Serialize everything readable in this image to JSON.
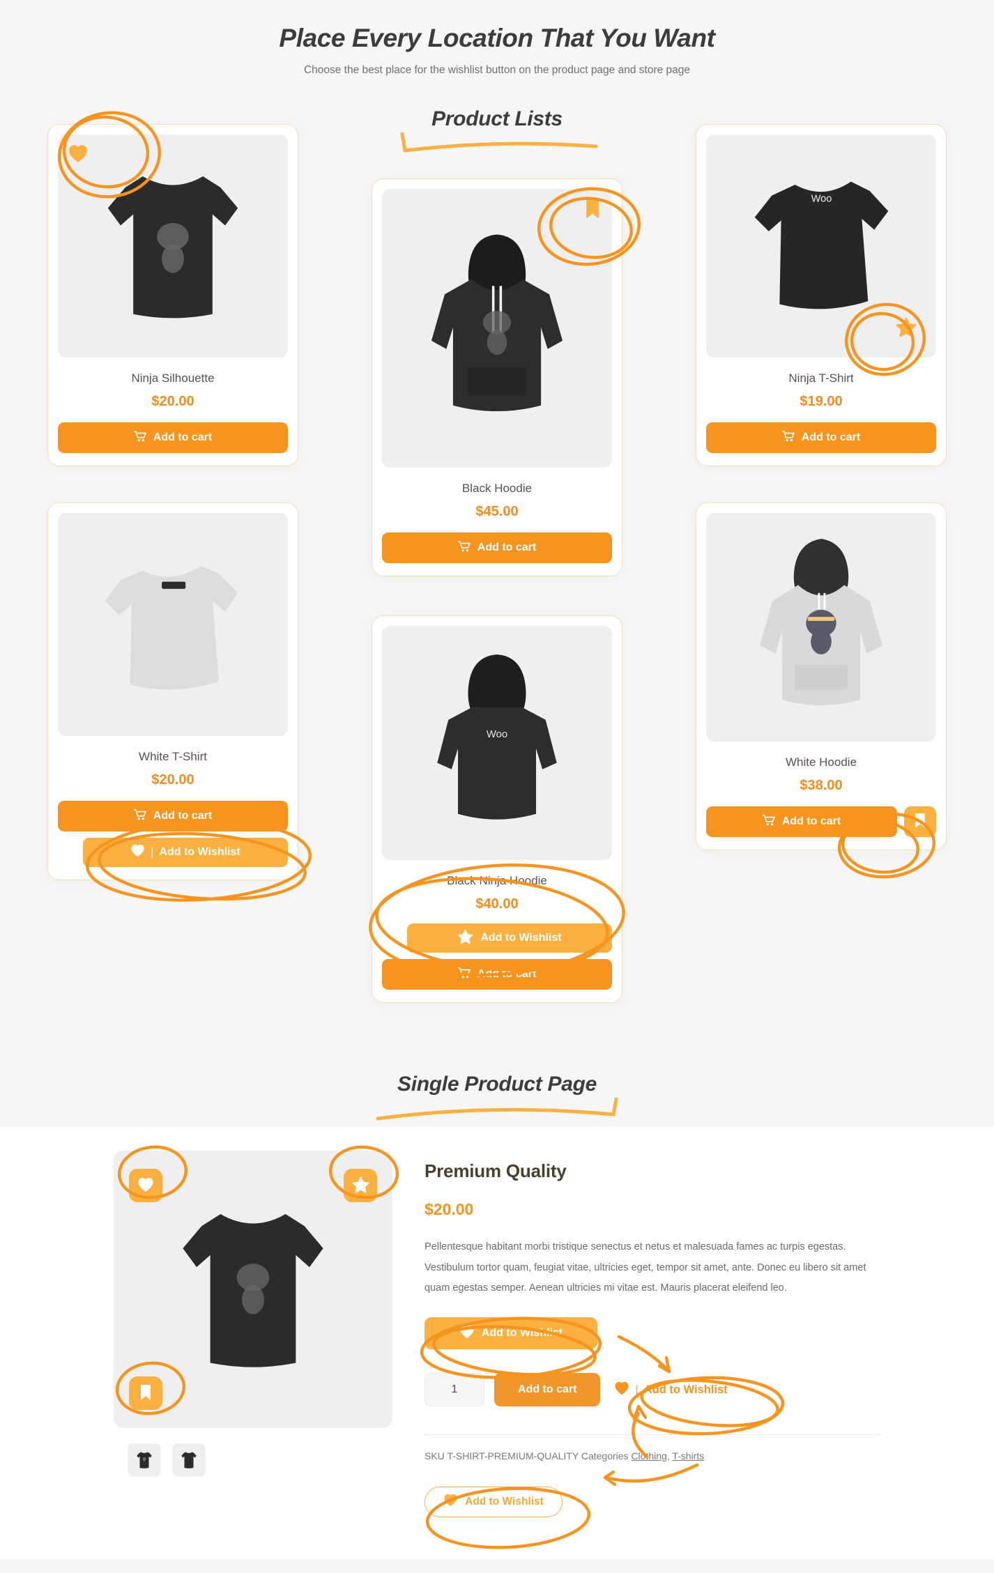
{
  "header": {
    "title": "Place Every Location That You Want",
    "subtitle": "Choose the best place for the wishlist button on the product page and store page"
  },
  "sections": {
    "product_lists_heading": "Product Lists",
    "single_product_heading": "Single Product Page"
  },
  "labels": {
    "add_to_cart": "Add to cart",
    "add_to_wishlist": "Add to Wishlist",
    "separator": "|"
  },
  "icons": {
    "heart": "heart-icon",
    "star": "star-icon",
    "bookmark": "bookmark-icon",
    "cart": "cart-icon"
  },
  "colors": {
    "orange": "#f7941e",
    "amber": "#fbb040",
    "card_border": "#fbdcb9",
    "text_dark": "#3c3c3b",
    "text_muted": "#6e7073"
  },
  "products": [
    {
      "name": "Ninja Silhouette",
      "price": "$20.00",
      "wishlist_placement": "image-top-left-heart"
    },
    {
      "name": "Black Hoodie",
      "price": "$45.00",
      "wishlist_placement": "image-top-right-bookmark"
    },
    {
      "name": "Ninja T-Shirt",
      "price": "$19.00",
      "wishlist_placement": "image-bottom-right-star"
    },
    {
      "name": "White T-Shirt",
      "price": "$20.00",
      "wishlist_placement": "below-add-to-cart"
    },
    {
      "name": "Black Ninja Hoodie",
      "price": "$40.00",
      "wishlist_placement": "above-add-to-cart"
    },
    {
      "name": "White Hoodie",
      "price": "$38.00",
      "wishlist_placement": "inline-right-of-cart"
    }
  ],
  "single_product": {
    "title": "Premium Quality",
    "price": "$20.00",
    "description": "Pellentesque habitant morbi tristique senectus et netus et malesuada fames ac turpis egestas. Vestibulum tortor quam, feugiat vitae, ultricies eget, tempor sit amet, ante. Donec eu libero sit amet quam egestas semper. Aenean ultricies mi vitae est. Mauris placerat eleifend leo.",
    "quantity": "1",
    "meta": {
      "sku_label": "SKU",
      "sku_value": "T-SHIRT-PREMIUM-QUALITY",
      "categories_label": "Categories",
      "categories": [
        "Clothing",
        "T-shirts"
      ],
      "categories_separator": ", "
    }
  }
}
